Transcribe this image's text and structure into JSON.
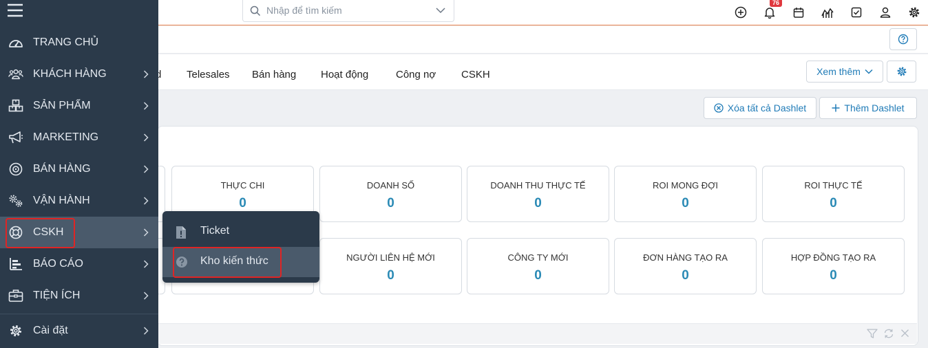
{
  "search": {
    "placeholder": "Nhập để tìm kiếm"
  },
  "header": {
    "notification_count": "76"
  },
  "tabs": [
    {
      "label": "d"
    },
    {
      "label": "Telesales"
    },
    {
      "label": "Bán hàng"
    },
    {
      "label": "Hoạt động"
    },
    {
      "label": "Công nợ"
    },
    {
      "label": "CSKH"
    }
  ],
  "toolbar": {
    "more_label": "Xem thêm"
  },
  "actions": {
    "clear_all": "Xóa tất cả Dashlet",
    "add": "Thêm Dashlet"
  },
  "stats_row1": [
    {
      "label": "Thực chi",
      "value": "0"
    },
    {
      "label": "Doanh số",
      "value": "0"
    },
    {
      "label": "Doanh thu thực tế",
      "value": "0"
    },
    {
      "label": "ROI mong đợi",
      "value": "0"
    },
    {
      "label": "ROI thực tế",
      "value": "0"
    }
  ],
  "stats_row2": [
    {
      "label": "Người liên hệ mới",
      "value": "0"
    },
    {
      "label": "Công ty mới",
      "value": "0"
    },
    {
      "label": "Đơn hàng tạo ra",
      "value": "0"
    },
    {
      "label": "Hợp đồng tạo ra",
      "value": "0"
    }
  ],
  "sidebar": {
    "items": [
      {
        "label": "TRANG CHỦ",
        "icon": "dashboard-icon"
      },
      {
        "label": "KHÁCH HÀNG",
        "icon": "users-icon"
      },
      {
        "label": "SẢN PHẨM",
        "icon": "boxes-icon"
      },
      {
        "label": "MARKETING",
        "icon": "megaphone-icon"
      },
      {
        "label": "BÁN HÀNG",
        "icon": "target-icon"
      },
      {
        "label": "VẬN HÀNH",
        "icon": "cogs-icon"
      },
      {
        "label": "CSKH",
        "icon": "lifebuoy-icon"
      },
      {
        "label": "BÁO CÁO",
        "icon": "bar-chart-icon"
      },
      {
        "label": "TIỆN ÍCH",
        "icon": "briefcase-icon"
      },
      {
        "label": "Cài đặt",
        "icon": "gear-icon"
      }
    ]
  },
  "submenu": {
    "items": [
      {
        "label": "Ticket",
        "icon": "file-alert-icon"
      },
      {
        "label": "Kho kiến thức",
        "icon": "question-circle-icon"
      }
    ]
  },
  "colors": {
    "sidebar_bg": "#2b3a4a",
    "sidebar_active": "#4a5a6b",
    "accent": "#2a8ab5",
    "highlight": "#e02424"
  }
}
